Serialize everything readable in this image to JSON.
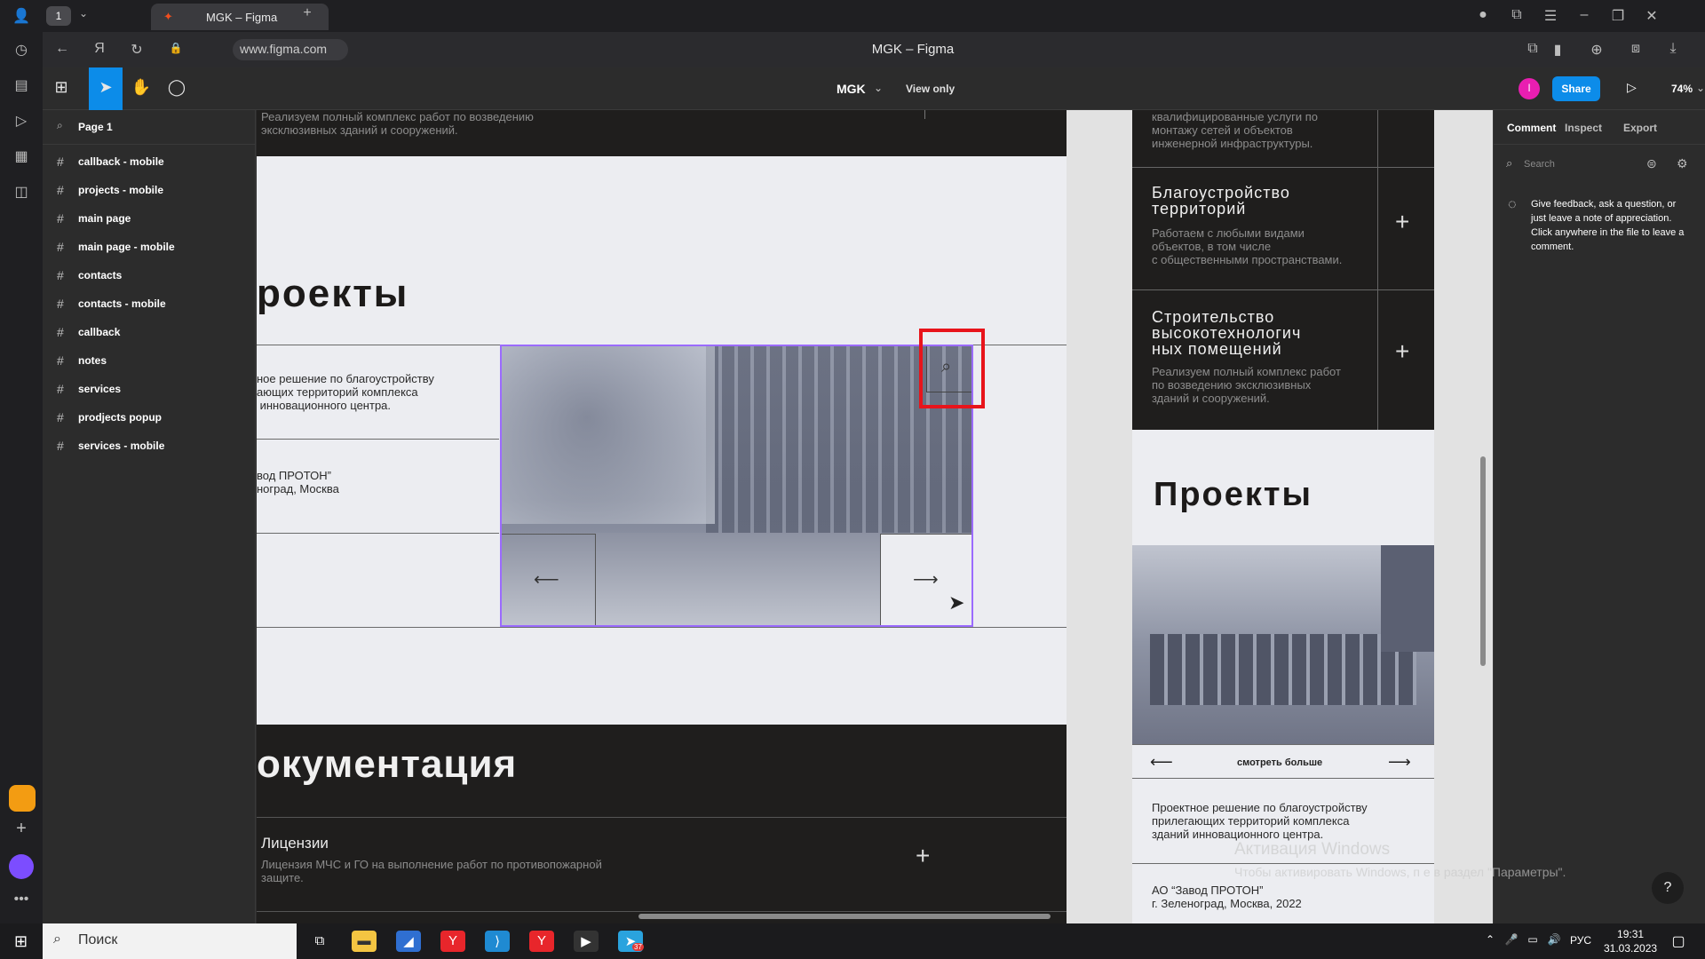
{
  "browser": {
    "tab_title": "MGK – Figma",
    "tab_count": "1",
    "url": "www.figma.com",
    "window_title": "MGK – Figma"
  },
  "toolbar": {
    "file_name": "MGK",
    "view_mode": "View only",
    "avatar_initial": "I",
    "share_label": "Share",
    "zoom": "74%"
  },
  "left_panel": {
    "page": "Page 1",
    "layers": [
      "callback - mobile",
      "projects - mobile",
      "main page",
      "main page - mobile",
      "contacts",
      "contacts - mobile",
      "callback",
      "notes",
      "services",
      "prodjects popup",
      "services - mobile"
    ]
  },
  "canvas": {
    "desktop": {
      "top_text": "Реализуем полный комплекс работ по возведению\nэксклюзивных зданий и сооружений.",
      "projects_heading": "роекты",
      "project_desc": "ное решение по благоустройству\nающих территорий комплекса\n инновационного центра.",
      "project_client": "вод ПРОТОН”\nноград, Москва",
      "arrow_left": "⟵",
      "arrow_right": "⟶",
      "docs_heading": "окументация",
      "license_title": "Лицензии",
      "license_text": "Лицензия МЧС и ГО на выполнение работ по противопожарной\nзащите.",
      "plus": "+"
    },
    "mobile": {
      "top_text": "квалифицированные услуги по\nмонтажу сетей и объектов\nинженерной инфраструктуры.",
      "service1_title": "Благоустройство\nтерриторий",
      "service1_text": "Работаем с любыми видами\nобъектов, в том числе\nс общественными пространствами.",
      "service2_title": "Строительство\nвысокотехнологич\nных помещений",
      "service2_text": "Реализуем полный комплекс работ\nпо возведению эксклюзивных\nзданий и сооружений.",
      "projects_heading": "Проекты",
      "see_more": "смотреть больше",
      "project_desc": "Проектное решение по благоустройству\nприлегающих территорий комплекса\nзданий инновационного центра.",
      "project_client": "АО “Завод ПРОТОН”\nг. Зеленоград, Москва, 2022",
      "plus": "+"
    }
  },
  "right_panel": {
    "tabs": [
      "Comment",
      "Inspect",
      "Export"
    ],
    "search_placeholder": "Search",
    "feedback": "Give feedback, ask a question, or just leave a note of appreciation. Click anywhere in the file to leave a comment."
  },
  "windows_watermark": {
    "title": "Активация Windows",
    "text": "Чтобы активировать Windows, п              е в раздел \"Параметры\"."
  },
  "taskbar": {
    "search": "Поиск",
    "lang": "РУС",
    "time": "19:31",
    "date": "31.03.2023",
    "telegram_badge": "37"
  },
  "help": "?"
}
